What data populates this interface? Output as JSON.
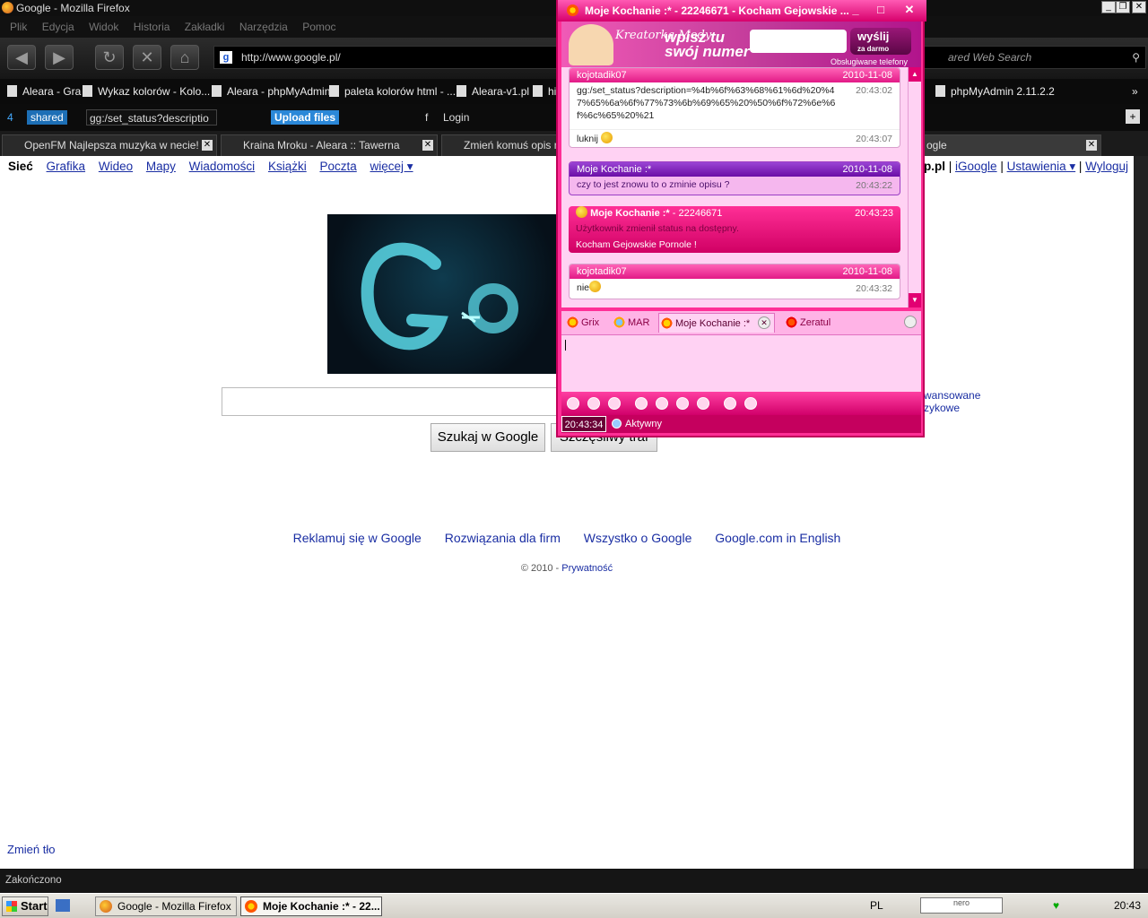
{
  "firefox": {
    "title": "Google - Mozilla Firefox",
    "menu": [
      "Plik",
      "Edycja",
      "Widok",
      "Historia",
      "Zakładki",
      "Narzędzia",
      "Pomoc"
    ],
    "url": "http://www.google.pl/",
    "search_placeholder": "ared Web Search",
    "bookmarks": [
      "Aleara - Gra",
      "Wykaz kolorów - Kolo...",
      "Aleara - phpMyAdmin",
      "paleta kolorów html - ...",
      "Aleara-v1.pl",
      "hi",
      "phpMyAdmin 2.11.2.2"
    ],
    "toolbar": {
      "shared": "shared",
      "search_value": "gg:/set_status?descriptio",
      "upload": "Upload files",
      "login": "Login"
    },
    "tabs": [
      "OpenFM Najlepsza muzyka w necie!",
      "Kraina Mroku - Aleara :: Tawerna",
      "Zmień komuś opis na",
      "ogle"
    ],
    "status": "Zakończono"
  },
  "google": {
    "bar_bold": "Sieć",
    "bar_links": [
      "Grafika",
      "Wideo",
      "Mapy",
      "Wiadomości",
      "Książki",
      "Poczta",
      "więcej ▾"
    ],
    "bar_right_bold": "p.pl",
    "bar_right_links": [
      "iGoogle",
      "Ustawienia ▾",
      "Wyloguj"
    ],
    "search_button": "Szukaj w Google",
    "lucky_button": "Szczęśliwy traf",
    "adv": [
      "wansowane",
      "zykowe"
    ],
    "footer_links": [
      "Reklamuj się w Google",
      "Rozwiązania dla firm",
      "Wszystko o Google",
      "Google.com in English"
    ],
    "copyright": "© 2010 -",
    "privacy": "Prywatność",
    "change_bg": "Zmień tło"
  },
  "gg": {
    "title": "Moje Kochanie :* - 22246671 - Kocham Gejowskie ...",
    "banner_text_1": "wpisz tu",
    "banner_text_2": "swój numer",
    "banner_send": "wyślij",
    "banner_free": "za darmo",
    "banner_phones": "Obsługiwane telefony",
    "messages": [
      {
        "sender": "kojotadik07",
        "date": "2010-11-08",
        "text": "gg:/set_status?description=%4b%6f%63%68%61%6d%20%47%65%6a%6f%77%73%6b%69%65%20%50%6f%72%6e%6f%6c%65%20%21",
        "time": "20:43:02"
      },
      {
        "text": "luknij",
        "time": "20:43:07"
      },
      {
        "sender": "Moje Kochanie :*",
        "date": "2010-11-08",
        "text": "czy to jest znowu to o zminie opisu ?",
        "time": "20:43:22"
      },
      {
        "sender": "Moje Kochanie :*",
        "sender_suffix": "- 22246671",
        "time": "20:43:23",
        "line1": "Użytkownik zmienił status na dostępny.",
        "line2": "Kocham Gejowskie Pornole !"
      },
      {
        "sender": "kojotadik07",
        "date": "2010-11-08",
        "text": "nie",
        "time": "20:43:32"
      }
    ],
    "tabs": [
      "Grix",
      "MAR",
      "Moje Kochanie :*",
      "Zeratul"
    ],
    "clock": "20:43:34",
    "status": "Aktywny"
  },
  "taskbar": {
    "start": "Start",
    "tasks": [
      "Google - Mozilla Firefox",
      "Moje Kochanie :* - 22..."
    ],
    "lang": "PL",
    "search": "nero",
    "time": "20:43"
  }
}
